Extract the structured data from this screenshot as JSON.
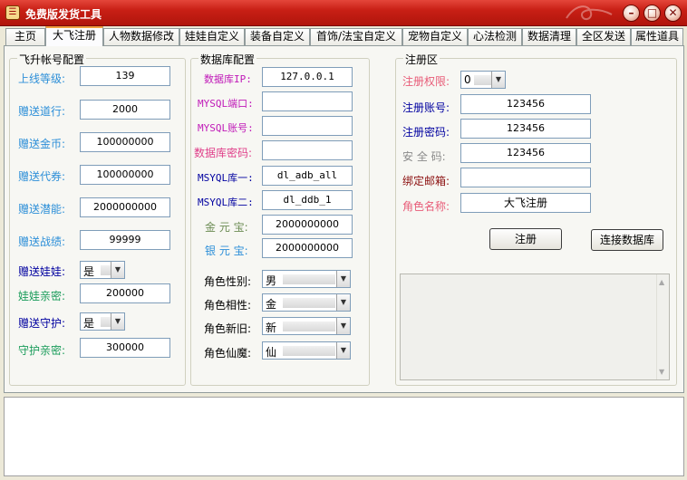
{
  "window": {
    "title": "免费版发货工具"
  },
  "tabs": [
    "主页",
    "大飞注册",
    "人物数据修改",
    "娃娃自定义",
    "装备自定义",
    "首饰/法宝自定义",
    "宠物自定义",
    "心法检测",
    "数据清理",
    "全区发送",
    "属性道具"
  ],
  "active_tab": "大飞注册",
  "left_group": {
    "legend": "飞升帐号配置",
    "fields": [
      {
        "label": "上线等级:",
        "value": "139"
      },
      {
        "label": "赠送道行:",
        "value": "2000"
      },
      {
        "label": "赠送金币:",
        "value": "100000000"
      },
      {
        "label": "赠送代券:",
        "value": "100000000"
      },
      {
        "label": "赠送潜能:",
        "value": "2000000000"
      },
      {
        "label": "赠送战绩:",
        "value": "99999"
      }
    ],
    "gift_doll": {
      "label": "赠送娃娃:",
      "value": "是"
    },
    "doll_intimacy": {
      "label": "娃娃亲密:",
      "value": "200000"
    },
    "gift_guard": {
      "label": "赠送守护:",
      "value": "是"
    },
    "guard_intimacy": {
      "label": "守护亲密:",
      "value": "300000"
    }
  },
  "mid_group": {
    "legend": "数据库配置",
    "fields": [
      {
        "label": "数据库IP:",
        "value": "127.0.0.1"
      },
      {
        "label": "MYSQL端口:",
        "value": ""
      },
      {
        "label": "MYSQL账号:",
        "value": ""
      },
      {
        "label": "数据库密码:",
        "value": ""
      },
      {
        "label": "MSYQL库一:",
        "value": "dl_adb_all"
      },
      {
        "label": "MSYQL库二:",
        "value": "dl_ddb_1"
      },
      {
        "label": "金 元 宝:",
        "value": "2000000000"
      },
      {
        "label": "银 元 宝:",
        "value": "2000000000"
      }
    ],
    "combos": [
      {
        "label": "角色性别:",
        "value": "男"
      },
      {
        "label": "角色相性:",
        "value": "金"
      },
      {
        "label": "角色新旧:",
        "value": "新"
      },
      {
        "label": "角色仙魔:",
        "value": "仙"
      }
    ]
  },
  "right_group": {
    "legend": "注册区",
    "permission": {
      "label": "注册权限:",
      "value": "0"
    },
    "fields": [
      {
        "label": "注册账号:",
        "value": "123456"
      },
      {
        "label": "注册密码:",
        "value": "123456"
      },
      {
        "label": "安 全 码:",
        "value": "123456"
      },
      {
        "label": "绑定邮箱:",
        "value": ""
      },
      {
        "label": "角色名称:",
        "value": "大飞注册"
      }
    ],
    "register_button": "注册",
    "connect_button": "连接数据库"
  }
}
